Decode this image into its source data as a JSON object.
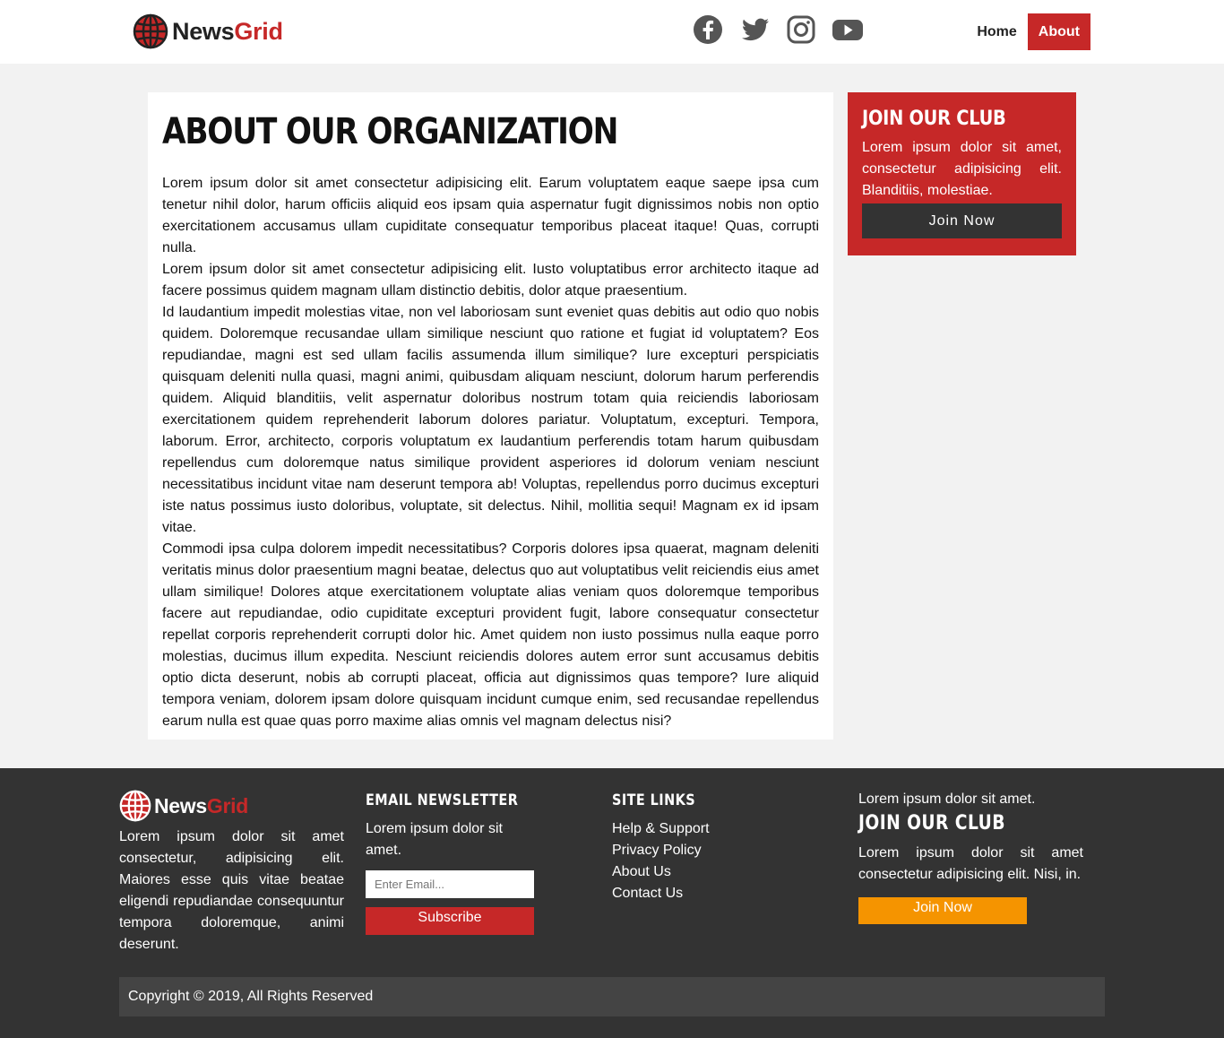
{
  "brand": {
    "name_part1": "News",
    "name_part2": "Grid"
  },
  "social": {
    "icons": [
      "facebook-icon",
      "twitter-icon",
      "instagram-icon",
      "youtube-icon"
    ],
    "color": "#555555"
  },
  "nav": {
    "home": "Home",
    "about": "About",
    "active": "About",
    "accent": "#c62828"
  },
  "article": {
    "title": "ABOUT OUR ORGANIZATION",
    "paragraphs": [
      "Lorem ipsum dolor sit amet consectetur adipisicing elit. Earum voluptatem eaque saepe ipsa cum tenetur nihil dolor, harum officiis aliquid eos ipsam quia aspernatur fugit dignissimos nobis non optio exercitationem accusamus ullam cupiditate consequatur temporibus placeat itaque! Quas, corrupti nulla.",
      "Lorem ipsum dolor sit amet consectetur adipisicing elit. Iusto voluptatibus error architecto itaque ad facere possimus quidem magnam ullam distinctio debitis, dolor atque praesentium.",
      "Id laudantium impedit molestias vitae, non vel laboriosam sunt eveniet quas debitis aut odio quo nobis quidem. Doloremque recusandae ullam similique nesciunt quo ratione et fugiat id voluptatem? Eos repudiandae, magni est sed ullam facilis assumenda illum similique? Iure excepturi perspiciatis quisquam deleniti nulla quasi, magni animi, quibusdam aliquam nesciunt, dolorum harum perferendis quidem. Aliquid blanditiis, velit aspernatur doloribus nostrum totam quia reiciendis laboriosam exercitationem quidem reprehenderit laborum dolores pariatur. Voluptatum, excepturi. Tempora, laborum. Error, architecto, corporis voluptatum ex laudantium perferendis totam harum quibusdam repellendus cum doloremque natus similique provident asperiores id dolorum veniam nesciunt necessitatibus incidunt vitae nam deserunt tempora ab! Voluptas, repellendus porro ducimus excepturi iste natus possimus iusto doloribus, voluptate, sit delectus. Nihil, mollitia sequi! Magnam ex id ipsam vitae.",
      "Commodi ipsa culpa dolorem impedit necessitatibus? Corporis dolores ipsa quaerat, magnam deleniti veritatis minus dolor praesentium magni beatae, delectus quo aut voluptatibus velit reiciendis eius amet ullam similique! Dolores atque exercitationem voluptate alias veniam quos doloremque temporibus facere aut repudiandae, odio cupiditate excepturi provident fugit, labore consequatur consectetur repellat corporis reprehenderit corrupti dolor hic. Amet quidem non iusto possimus nulla eaque porro molestias, ducimus illum expedita. Nesciunt reiciendis dolores autem error sunt accusamus debitis optio dicta deserunt, nobis ab corrupti placeat, officia aut dignissimos quas tempore? Iure aliquid tempora veniam, dolorem ipsam dolore quisquam incidunt cumque enim, sed recusandae repellendus earum nulla est quae quas porro maxime alias omnis vel magnam delectus nisi?"
    ]
  },
  "club": {
    "title": "JOIN OUR CLUB",
    "text": "Lorem ipsum dolor sit amet, consectetur adipisicing elit. Blanditiis, molestiae.",
    "button": "Join Now"
  },
  "footer": {
    "about": "Lorem ipsum dolor sit amet consectetur, adipisicing elit. Maiores esse quis vitae beatae eligendi repudiandae consequuntur tempora doloremque, animi deserunt.",
    "newsletter": {
      "title": "EMAIL NEWSLETTER",
      "text": "Lorem ipsum dolor sit amet.",
      "placeholder": "Enter Email...",
      "button": "Subscribe"
    },
    "links": {
      "title": "SITE LINKS",
      "items": [
        "Help & Support",
        "Privacy Policy",
        "About Us",
        "Contact Us"
      ]
    },
    "club": {
      "intro": "Lorem ipsum dolor sit amet.",
      "title": "JOIN OUR CLUB",
      "text": "Lorem ipsum dolor sit amet consectetur adipisicing elit. Nisi, in.",
      "button": "Join Now",
      "button_color": "#f59400"
    },
    "copyright": "Copyright © 2019, All Rights Reserved"
  }
}
